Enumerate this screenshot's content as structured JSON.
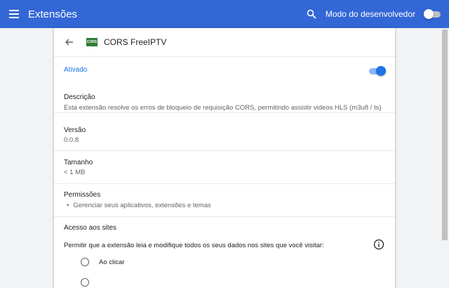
{
  "header": {
    "title": "Extensões",
    "dev_mode_label": "Modo do desenvolvedor"
  },
  "extension": {
    "name": "CORS FreeIPTV",
    "logo_text": "CORS",
    "enabled_label": "Ativado",
    "description_label": "Descrição",
    "description": "Esta extensão resolve os erros de bloqueio de requisição CORS, permitindo assistir videos HLS (m3u8 / ts)",
    "version_label": "Versão",
    "version": "0.0.8",
    "size_label": "Tamanho",
    "size": "< 1 MB",
    "permissions_label": "Permissões",
    "permissions": [
      "Gerenciar seus aplicativos, extensões e temas"
    ],
    "site_access_label": "Acesso aos sites",
    "site_access_desc": "Permitir que a extensão leia e modifique todos os seus dados nos sites que você visitar:",
    "site_access_options": [
      "Ao clicar"
    ]
  },
  "colors": {
    "header_bg": "#3367d6",
    "accent": "#1a73e8",
    "logo_bg": "#2e7d32"
  },
  "icons": [
    "menu-icon",
    "search-icon",
    "back-arrow-icon",
    "info-icon"
  ]
}
